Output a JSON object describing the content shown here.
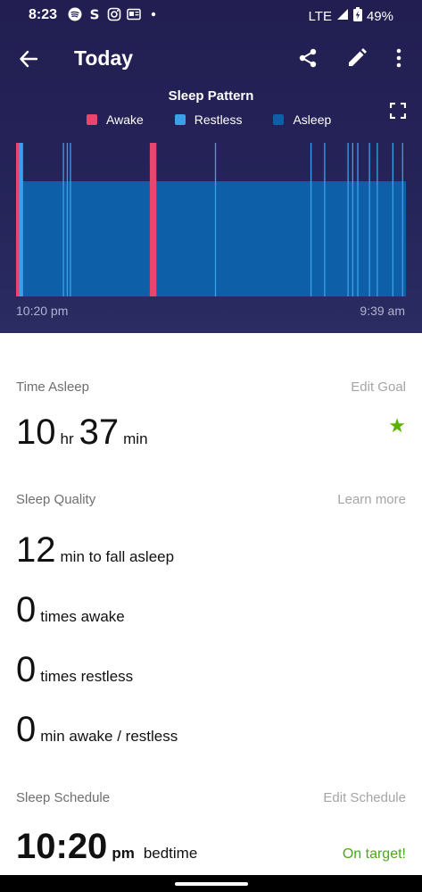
{
  "status": {
    "time": "8:23",
    "network": "LTE",
    "battery": "49%"
  },
  "header": {
    "title": "Today"
  },
  "chart_title": "Sleep Pattern",
  "legend": [
    {
      "label": "Awake",
      "color": "#e8466e"
    },
    {
      "label": "Restless",
      "color": "#3aa0e8"
    },
    {
      "label": "Asleep",
      "color": "#0d5fa8"
    }
  ],
  "chart_data": {
    "type": "bar",
    "title": "Sleep Pattern",
    "x_start_label": "10:20 pm",
    "x_end_label": "9:39 am",
    "levels": {
      "awake": 1,
      "restless": 1,
      "asleep": 0.75
    },
    "series": [
      {
        "name": "Asleep",
        "color": "#0d5fa8",
        "segments": [
          {
            "start": 0.0,
            "end": 1.0
          }
        ]
      },
      {
        "name": "Awake",
        "color": "#e8466e",
        "segments": [
          {
            "start": 0.0,
            "end": 0.008
          },
          {
            "start": 0.343,
            "end": 0.36
          }
        ]
      },
      {
        "name": "Restless",
        "color": "#3aa0e8",
        "segments": [
          {
            "start": 0.008,
            "end": 0.018
          },
          {
            "start": 0.12,
            "end": 0.123
          },
          {
            "start": 0.13,
            "end": 0.133
          },
          {
            "start": 0.138,
            "end": 0.141
          },
          {
            "start": 0.51,
            "end": 0.513
          },
          {
            "start": 0.755,
            "end": 0.758
          },
          {
            "start": 0.79,
            "end": 0.793
          },
          {
            "start": 0.85,
            "end": 0.853
          },
          {
            "start": 0.862,
            "end": 0.865
          },
          {
            "start": 0.875,
            "end": 0.878
          },
          {
            "start": 0.905,
            "end": 0.908
          },
          {
            "start": 0.925,
            "end": 0.928
          },
          {
            "start": 0.965,
            "end": 0.968
          },
          {
            "start": 0.99,
            "end": 0.993
          }
        ]
      }
    ]
  },
  "time_asleep": {
    "label": "Time Asleep",
    "link": "Edit Goal",
    "hours": "10",
    "hours_unit": "hr",
    "minutes": "37",
    "minutes_unit": "min"
  },
  "sleep_quality": {
    "label": "Sleep Quality",
    "link": "Learn more",
    "stats": [
      {
        "value": "12",
        "text": "min to fall asleep"
      },
      {
        "value": "0",
        "text": "times awake"
      },
      {
        "value": "0",
        "text": "times restless"
      },
      {
        "value": "0",
        "text": "min awake / restless"
      }
    ]
  },
  "sleep_schedule": {
    "label": "Sleep Schedule",
    "link": "Edit Schedule",
    "time": "10:20",
    "ampm": "pm",
    "text": "bedtime",
    "status": "On target!"
  }
}
